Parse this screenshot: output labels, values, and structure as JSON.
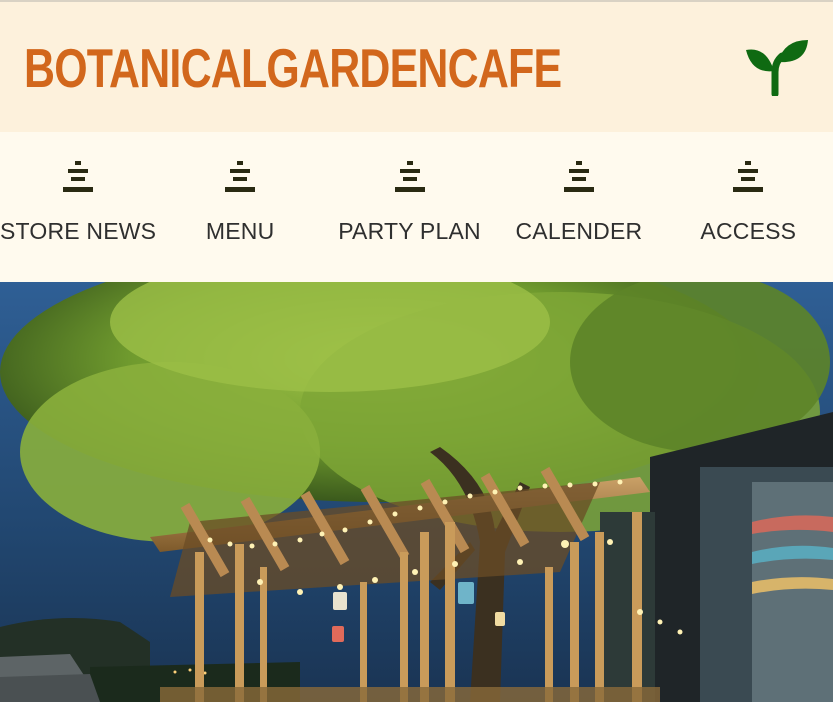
{
  "header": {
    "brand": "BOTANICALGARDENCAFE",
    "logo_icon": "sprout-icon",
    "brand_color": "#d2671c",
    "logo_color": "#0f6a12"
  },
  "nav": {
    "items": [
      {
        "label": "STORE NEWS",
        "icon": "menu-lines-icon"
      },
      {
        "label": "MENU",
        "icon": "menu-lines-icon"
      },
      {
        "label": "PARTY PLAN",
        "icon": "menu-lines-icon"
      },
      {
        "label": "CALENDER",
        "icon": "menu-lines-icon"
      },
      {
        "label": "ACCESS",
        "icon": "menu-lines-icon"
      }
    ]
  },
  "hero": {
    "image": "garden-terrace-night-photo"
  }
}
